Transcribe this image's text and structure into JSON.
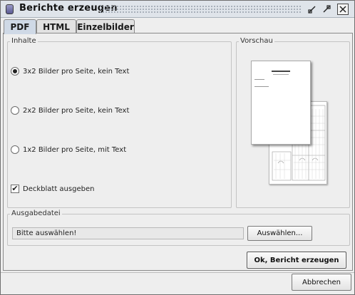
{
  "window": {
    "title": "Berichte erzeugen"
  },
  "tabs": [
    {
      "label": "PDF",
      "active": true
    },
    {
      "label": "HTML",
      "active": false
    },
    {
      "label": "Einzelbilder",
      "active": false
    }
  ],
  "inhalte": {
    "legend": "Inhalte",
    "options": [
      {
        "label": "3x2 Bilder pro Seite, kein Text",
        "selected": true
      },
      {
        "label": "2x2 Bilder pro Seite, kein Text",
        "selected": false
      },
      {
        "label": "1x2 Bilder pro Seite, mit Text",
        "selected": false
      }
    ],
    "cover": {
      "label": "Deckblatt ausgeben",
      "checked": true,
      "mark": "✔"
    }
  },
  "vorschau": {
    "legend": "Vorschau"
  },
  "ausgabe": {
    "legend": "Ausgabedatei",
    "field_value": "Bitte auswählen!",
    "choose_label": "Auswählen..."
  },
  "actions": {
    "ok_label": "Ok, Bericht erzeugen",
    "cancel_label": "Abbrechen"
  },
  "icons": {
    "app": "app-icon",
    "minimize": "minimize-icon",
    "maximize": "maximize-icon",
    "close": "close-icon"
  }
}
